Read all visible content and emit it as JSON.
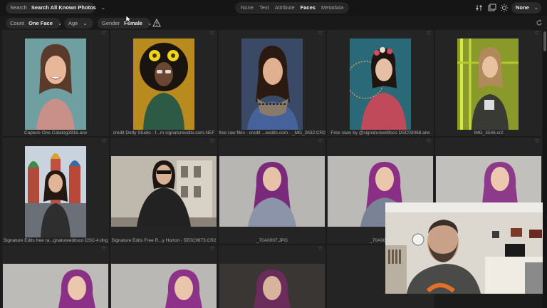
{
  "topbar": {
    "search_label": "Search",
    "search_value": "Search All Known Photos",
    "tabs": [
      {
        "label": "None",
        "active": false
      },
      {
        "label": "Text",
        "active": false
      },
      {
        "label": "Attribute",
        "active": false
      },
      {
        "label": "Faces",
        "active": true
      },
      {
        "label": "Metadata",
        "active": false
      }
    ],
    "sort_value": "None"
  },
  "filters": {
    "count_label": "Count",
    "count_value": "One Face",
    "age_label": "Age",
    "gender_label": "Gender",
    "gender_value": "Female"
  },
  "grid": {
    "captions": [
      "Capture One Catalog3916.arw",
      "credit Detty Studio - f...m signatureedits.com.NEF",
      "free raw files - credit ...eedits.com - _MG_2632.CR2",
      "Free raws by @signatureeditsco DSC03068.arw",
      "IMG_3546.cr2",
      "Signature Edits free ra...gnatureeditsco DSC-4.dng",
      "Signature Edits Free R...y Horton - 5E0C9673.CR2",
      "_70A0007.JPG",
      "_70A0014",
      ""
    ]
  },
  "colors": {
    "background": "#1b1b1b",
    "pill": "#2a2a2a",
    "active_tab": "#f2f2f2"
  }
}
